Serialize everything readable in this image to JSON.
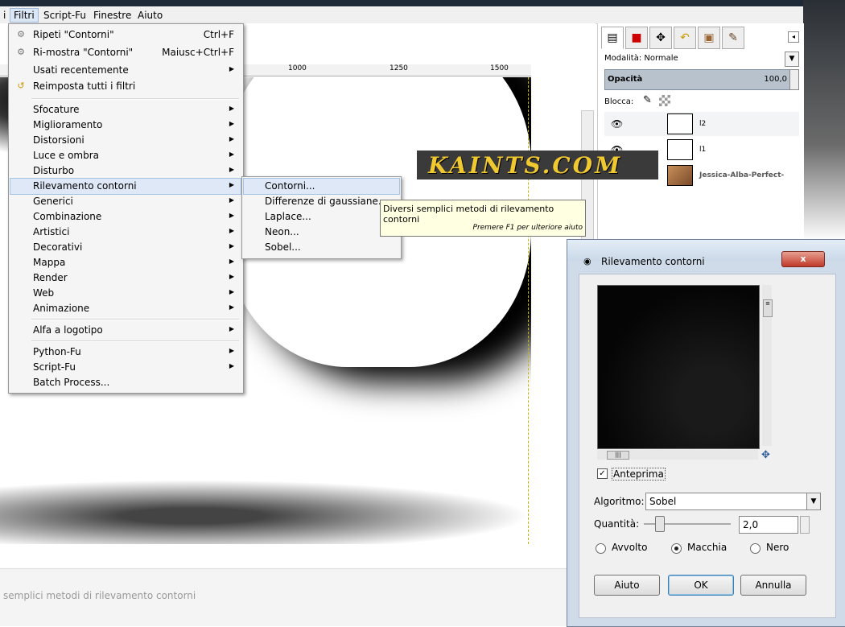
{
  "menubar": {
    "items": [
      {
        "label": "i"
      },
      {
        "label": "Filtri"
      },
      {
        "label": "Script-Fu"
      },
      {
        "label": "Finestre"
      },
      {
        "label": "Aiuto"
      }
    ]
  },
  "ruler": {
    "ticks": [
      "1000",
      "1250",
      "1500"
    ]
  },
  "statusbar": {
    "text": "semplici metodi di rilevamento contorni"
  },
  "watermark": {
    "text": "KAINTS.COM"
  },
  "filters_menu": {
    "items": [
      {
        "label": "Ripeti \"Contorni\"",
        "shortcut": "Ctrl+F",
        "icon": "repeat-icon"
      },
      {
        "label": "Ri-mostra \"Contorni\"",
        "shortcut": "Maiusc+Ctrl+F",
        "icon": "reshow-icon"
      },
      {
        "label": "Usati recentemente",
        "submenu": true
      },
      {
        "label": "Reimposta tutti i filtri",
        "icon": "reset-icon"
      },
      {
        "label": "Sfocature",
        "submenu": true
      },
      {
        "label": "Miglioramento",
        "submenu": true
      },
      {
        "label": "Distorsioni",
        "submenu": true
      },
      {
        "label": "Luce e ombra",
        "submenu": true
      },
      {
        "label": "Disturbo",
        "submenu": true
      },
      {
        "label": "Rilevamento contorni",
        "submenu": true,
        "highlighted": true
      },
      {
        "label": "Generici",
        "submenu": true
      },
      {
        "label": "Combinazione",
        "submenu": true
      },
      {
        "label": "Artistici",
        "submenu": true
      },
      {
        "label": "Decorativi",
        "submenu": true
      },
      {
        "label": "Mappa",
        "submenu": true
      },
      {
        "label": "Render",
        "submenu": true
      },
      {
        "label": "Web",
        "submenu": true
      },
      {
        "label": "Animazione",
        "submenu": true
      },
      {
        "label": "Alfa a logotipo",
        "submenu": true
      },
      {
        "label": "Python-Fu",
        "submenu": true
      },
      {
        "label": "Script-Fu",
        "submenu": true
      },
      {
        "label": "Batch Process..."
      }
    ]
  },
  "edge_submenu": {
    "items": [
      {
        "label": "Contorni..."
      },
      {
        "label": "Differenze di gaussiane..."
      },
      {
        "label": "Laplace..."
      },
      {
        "label": "Neon..."
      },
      {
        "label": "Sobel..."
      }
    ]
  },
  "tooltip": {
    "text": "Diversi semplici metodi di rilevamento contorni",
    "hint": "Premere F1 per ulteriore aiuto"
  },
  "layers_panel": {
    "mode_label": "Modalità: Normale",
    "opacity_label": "Opacità",
    "opacity_value": "100,0",
    "lock_label": "Blocca:",
    "layers": [
      {
        "name": "l2"
      },
      {
        "name": "l1"
      },
      {
        "name": "Jessica-Alba-Perfect-"
      }
    ]
  },
  "dialog": {
    "title": "Rilevamento contorni",
    "close": "x",
    "preview_label": "Anteprima",
    "preview_checked": true,
    "algorithm_label": "Algoritmo:",
    "algorithm_value": "Sobel",
    "quantity_label": "Quantità:",
    "quantity_value": "2,0",
    "radio": {
      "wrap": "Avvolto",
      "smear": "Macchia",
      "black": "Nero",
      "selected": "Macchia"
    },
    "buttons": {
      "help": "Aiuto",
      "ok": "OK",
      "cancel": "Annulla"
    }
  }
}
